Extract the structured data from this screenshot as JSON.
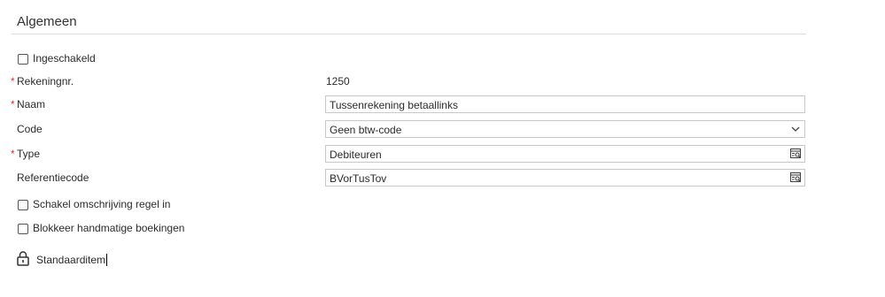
{
  "section": {
    "title": "Algemeen"
  },
  "enabled": {
    "label": "Ingeschakeld",
    "checked": false
  },
  "account_number": {
    "label": "Rekeningnr.",
    "required_mark": "*",
    "value": "1250"
  },
  "name": {
    "label": "Naam",
    "required_mark": "*",
    "value": "Tussenrekening betaallinks"
  },
  "code": {
    "label": "Code",
    "value": "Geen btw-code",
    "icon": "chevron-down-icon"
  },
  "type": {
    "label": "Type",
    "required_mark": "*",
    "value": "Debiteuren",
    "icon": "lookup-icon"
  },
  "reference_code": {
    "label": "Referentiecode",
    "value": "BVorTusTov",
    "icon": "lookup-icon"
  },
  "line_description": {
    "label": "Schakel omschrijving regel in",
    "checked": false
  },
  "block_manual": {
    "label": "Blokkeer handmatige boekingen",
    "checked": false
  },
  "default_item": {
    "label": "Standaarditem",
    "icon": "lock-icon"
  },
  "colors": {
    "required": "#d9372b",
    "border": "#c8c8c8",
    "text": "#2b2b2b"
  }
}
